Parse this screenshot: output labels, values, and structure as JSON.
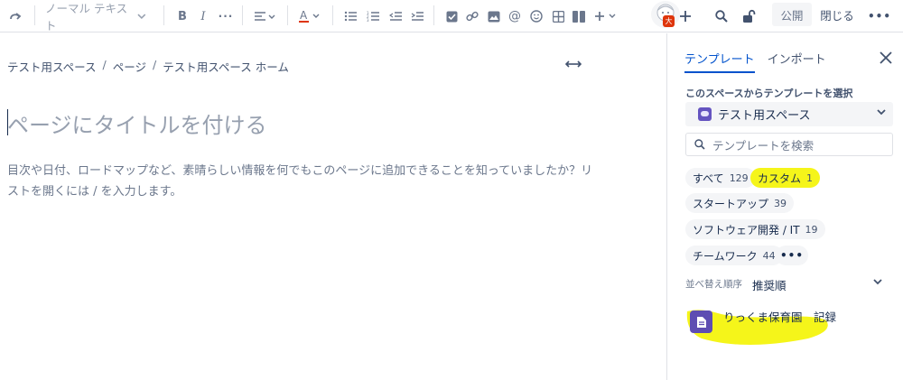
{
  "toolbar": {
    "text_style": "ノーマル テキスト",
    "publish_label": "公開",
    "close_label": "閉じる",
    "avatar_badge": "大",
    "accent_color": "#0052cc",
    "highlight_color": "#f5f51a"
  },
  "editor": {
    "breadcrumb": [
      "テスト用スペース",
      "ページ",
      "テスト用スペース ホーム"
    ],
    "breadcrumb_sep": "/",
    "title_placeholder": "ページにタイトルを付ける",
    "body_placeholder": "目次や日付、ロードマップなど、素晴らしい情報を何でもこのページに追加できることを知っていましたか？リストを開くには / を入力します。"
  },
  "sidebar": {
    "tabs": [
      {
        "label": "テンプレート",
        "active": true
      },
      {
        "label": "インポート",
        "active": false
      }
    ],
    "space_label": "このスペースからテンプレートを選択",
    "space_value": "テスト用スペース",
    "search_placeholder": "テンプレートを検索",
    "categories": [
      {
        "label": "すべて",
        "count": "129",
        "selected": false
      },
      {
        "label": "カスタム",
        "count": "1",
        "selected": true
      },
      {
        "label": "スタートアップ",
        "count": "39",
        "selected": false
      },
      {
        "label": "ソフトウェア開発 / IT",
        "count": "19",
        "selected": false
      },
      {
        "label": "チームワーク",
        "count": "44",
        "selected": false
      }
    ],
    "more_label": "•••",
    "sort_label": "並べ替え順序",
    "sort_value": "推奨順",
    "templates": [
      {
        "name": "りっくま保育園　記録",
        "icon": "document-icon"
      }
    ]
  }
}
